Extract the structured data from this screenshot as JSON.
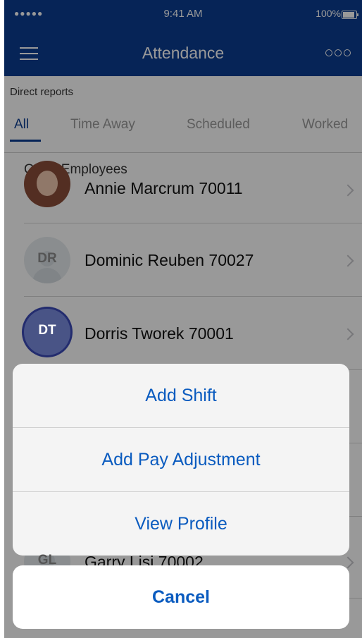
{
  "status_bar": {
    "signal": "●●●●●",
    "time": "9:41 AM",
    "battery_text": "100%",
    "battery_level": 1.0
  },
  "navbar": {
    "title": "Attendance",
    "menu_icon": "hamburger-menu-icon",
    "more_icon": "more-options-icon"
  },
  "subheader": {
    "label": "Direct reports",
    "tabs": [
      {
        "label": "All",
        "active": true
      },
      {
        "label": "Time Away",
        "active": false
      },
      {
        "label": "Scheduled",
        "active": false
      },
      {
        "label": "Worked",
        "active": false
      }
    ]
  },
  "list": {
    "section_label": "Other Employees",
    "rows": [
      {
        "name": "Annie Marcrum 70011",
        "initials": "",
        "avatar": "photo"
      },
      {
        "name": "Dominic Reuben 70027",
        "initials": "DR",
        "avatar": "placeholder"
      },
      {
        "name": "Dorris Tworek 70001",
        "initials": "DT",
        "avatar": "selected"
      },
      {
        "name": "Garry Lisi 70002",
        "initials": "GL",
        "avatar": "placeholder"
      }
    ]
  },
  "action_sheet": {
    "actions": [
      {
        "label": "Add Shift"
      },
      {
        "label": "Add Pay Adjustment"
      },
      {
        "label": "View Profile"
      }
    ],
    "cancel_label": "Cancel"
  },
  "colors": {
    "brand": "#0b3d91",
    "action_text": "#0a5bbf",
    "selected_avatar": "#7a8ce0"
  }
}
